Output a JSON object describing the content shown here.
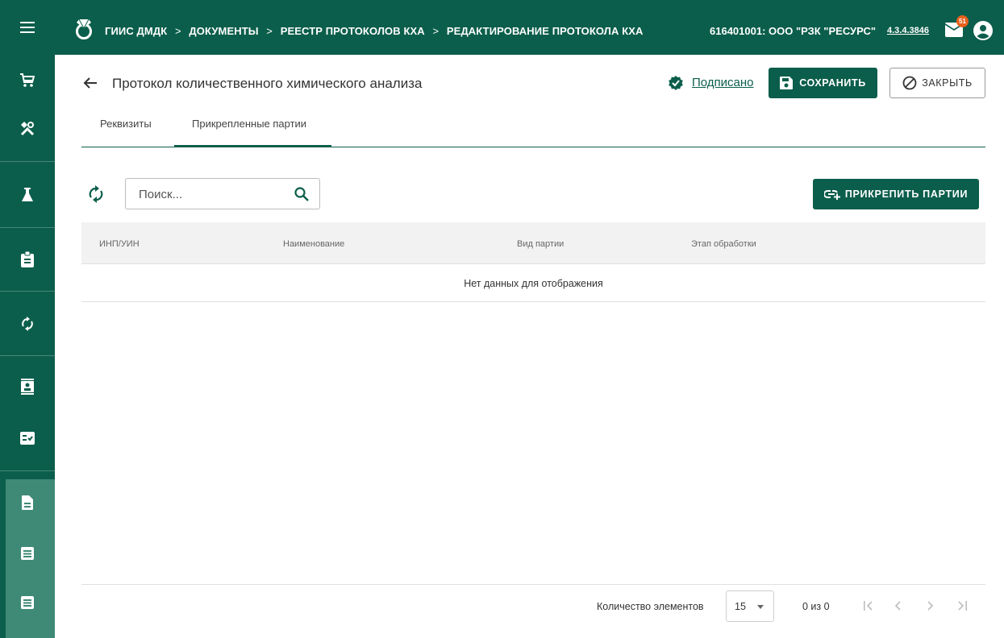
{
  "colors": {
    "primary": "#0b5e4b",
    "sidebar_active": "#3e8a76",
    "badge": "#e8601c"
  },
  "header": {
    "breadcrumbs": [
      "ГИИС ДМДК",
      "ДОКУМЕНТЫ",
      "РЕЕСТР ПРОТОКОЛОВ КХА",
      "РЕДАКТИРОВАНИЕ ПРОТОКОЛА КХА"
    ],
    "organization": "616401001: ООО \"РЗК \"РЕСУРС\"",
    "version": "4.3.4.3846",
    "mail_badge": "51",
    "icons": [
      "menu-icon",
      "logo-icon",
      "mail-icon",
      "user-account-icon"
    ]
  },
  "sidebar": {
    "items": [
      "cart-icon",
      "tools-icon",
      "flask-icon",
      "clipboard-icon",
      "sync-icon",
      "contact-card-icon",
      "checklist-icon",
      "document-icon",
      "list-icon",
      "list-icon"
    ]
  },
  "page": {
    "title": "Протокол количественного химического анализа",
    "status": "Подписано",
    "save_label": "СОХРАНИТЬ",
    "close_label": "ЗАКРЫТЬ"
  },
  "tabs": [
    {
      "label": "Реквизиты",
      "active": false
    },
    {
      "label": "Прикрепленные партии",
      "active": true
    }
  ],
  "toolbar": {
    "search_placeholder": "Поиск...",
    "attach_label": "ПРИКРЕПИТЬ ПАРТИИ"
  },
  "table": {
    "columns": [
      "ИНП/УИН",
      "Наименование",
      "Вид партии",
      "Этап обработки"
    ],
    "empty_text": "Нет данных для отображения"
  },
  "pagination": {
    "page_size_label": "Количество элементов",
    "page_size": "15",
    "range_text": "0 из 0"
  }
}
